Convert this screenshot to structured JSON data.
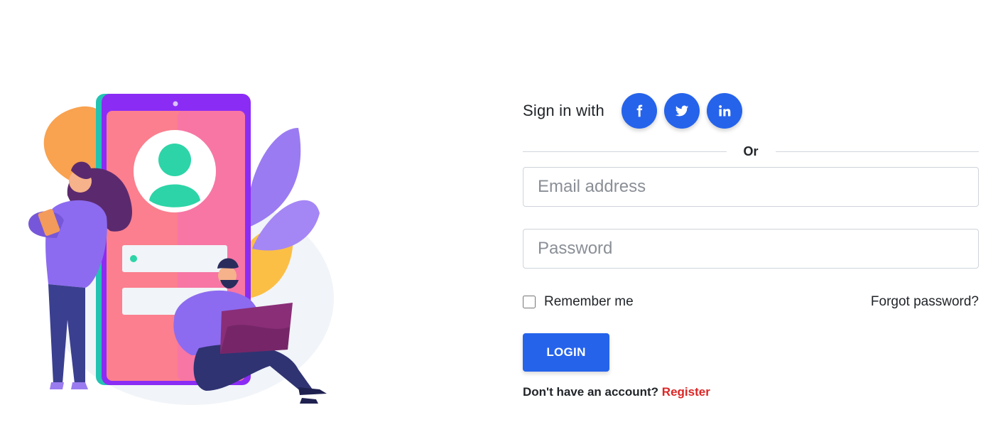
{
  "signin": {
    "label": "Sign in with",
    "social": [
      {
        "icon": "facebook-icon"
      },
      {
        "icon": "twitter-icon"
      },
      {
        "icon": "linkedin-icon"
      }
    ]
  },
  "divider": {
    "text": "Or"
  },
  "form": {
    "email": {
      "placeholder": "Email address",
      "value": ""
    },
    "password": {
      "placeholder": "Password",
      "value": ""
    },
    "remember_label": "Remember me",
    "remember_checked": false,
    "forgot_label": "Forgot password?",
    "login_label": "LOGIN"
  },
  "register": {
    "prompt": "Don't have an account?",
    "link_label": "Register"
  },
  "colors": {
    "accent": "#2563eb",
    "register_link": "#dc2626"
  }
}
